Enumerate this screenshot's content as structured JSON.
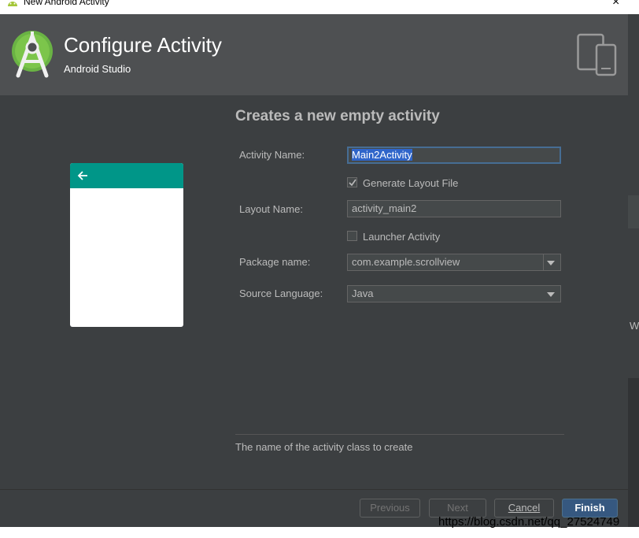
{
  "window": {
    "title": "New Android Activity",
    "close_glyph": "×"
  },
  "header": {
    "title": "Configure Activity",
    "subtitle": "Android Studio",
    "logo_icon": "android-studio-logo",
    "devices_icon": "tablet-phone-icon"
  },
  "preview": {
    "appbar_color": "#009688",
    "back_icon": "arrow-left-icon"
  },
  "form": {
    "heading": "Creates a new empty activity",
    "activity_name": {
      "label": "Activity Name:",
      "value": "Main2Activity"
    },
    "generate_layout": {
      "label": "Generate Layout File",
      "checked": true
    },
    "layout_name": {
      "label": "Layout Name:",
      "value": "activity_main2"
    },
    "launcher_activity": {
      "label": "Launcher Activity",
      "checked": false
    },
    "package_name": {
      "label": "Package name:",
      "value": "com.example.scrollview"
    },
    "source_language": {
      "label": "Source Language:",
      "value": "Java"
    }
  },
  "help_text": "The name of the activity class to create",
  "buttons": {
    "previous": "Previous",
    "next": "Next",
    "cancel": "Cancel",
    "finish": "Finish"
  },
  "background_fragment": "W",
  "watermark": "https://blog.csdn.net/qq_27524749",
  "colors": {
    "accent": "#365880",
    "selection": "#2f65ca",
    "android_green": "#a4c639"
  }
}
